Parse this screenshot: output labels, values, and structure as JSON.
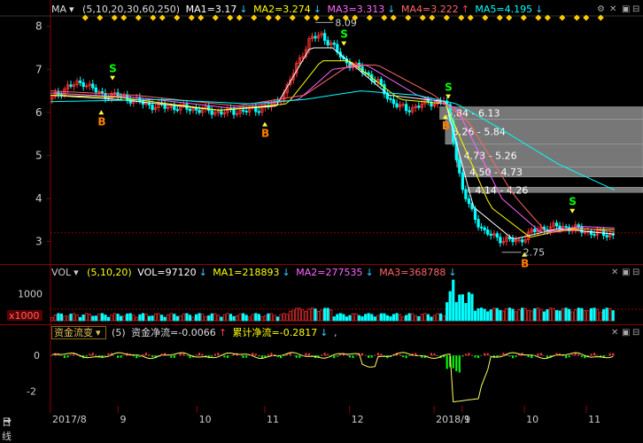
{
  "main_header": {
    "label": "MA",
    "params": "(5,10,20,30,60,250)",
    "ma1": "MA1=3.17",
    "ma2": "MA2=3.274",
    "ma3": "MA3=3.313",
    "ma4": "MA4=3.222",
    "ma5": "MA5=4.195",
    "ma1_arrow": "↓",
    "ma2_arrow": "↓",
    "ma3_arrow": "↓",
    "ma4_arrow": "↑",
    "ma5_arrow": "↓"
  },
  "vol_header": {
    "label": "VOL",
    "params": "(5,10,20)",
    "vol": "VOL=97120",
    "ma1": "MA1=218893",
    "ma2": "MA2=277535",
    "ma3": "MA3=368788",
    "vol_arrow": "↓",
    "ma1_arrow": "↓",
    "ma2_arrow": "↓",
    "ma3_arrow": "↓"
  },
  "flow_header": {
    "selector": "资金流变",
    "params": "(5)",
    "net": "资金净流=-0.0066",
    "cum": "累计净流=-0.2817",
    "net_arrow": "↑",
    "cum_arrow": "↓",
    "tail": ","
  },
  "bottom_bar": {
    "period": "日线",
    "period_arrow": "➜",
    "ticks": [
      "2017/8",
      "9",
      "10",
      "11",
      "12",
      "2018/1",
      "9",
      "10",
      "11"
    ]
  },
  "colors": {
    "up": "#ff3333",
    "down": "#00ffff",
    "ma1": "#ffffff",
    "ma2": "#ffff00",
    "ma3": "#ff66ff",
    "ma4": "#ff6666",
    "ma5": "#00ffff",
    "signal_b": "#ff7f00",
    "signal_s": "#00ff00",
    "grid_red": "#8b0000",
    "flow_line": "#ffff66"
  },
  "chart_data": [
    {
      "type": "candlestick",
      "y_ticks": [
        "8",
        "7",
        "6",
        "5",
        "4",
        "3"
      ],
      "ylim": [
        2.6,
        8.2
      ],
      "annotations": {
        "high": "8.09",
        "low": "2.75"
      },
      "signals": [
        {
          "label": "B",
          "t": 0.09
        },
        {
          "label": "S",
          "t": 0.11
        },
        {
          "label": "B",
          "t": 0.38
        },
        {
          "label": "S",
          "t": 0.52
        },
        {
          "label": "S",
          "t": 0.705
        },
        {
          "label": "B",
          "t": 0.7
        },
        {
          "label": "B",
          "t": 0.84
        },
        {
          "label": "S",
          "t": 0.925
        }
      ],
      "price_profile": [
        {
          "t": 0.0,
          "p": 6.3
        },
        {
          "t": 0.03,
          "p": 6.6
        },
        {
          "t": 0.06,
          "p": 6.7
        },
        {
          "t": 0.09,
          "p": 6.4
        },
        {
          "t": 0.12,
          "p": 6.4
        },
        {
          "t": 0.18,
          "p": 6.15
        },
        {
          "t": 0.24,
          "p": 6.1
        },
        {
          "t": 0.3,
          "p": 6.0
        },
        {
          "t": 0.36,
          "p": 6.05
        },
        {
          "t": 0.4,
          "p": 6.2
        },
        {
          "t": 0.42,
          "p": 6.6
        },
        {
          "t": 0.44,
          "p": 7.2
        },
        {
          "t": 0.46,
          "p": 7.7
        },
        {
          "t": 0.48,
          "p": 7.8
        },
        {
          "t": 0.5,
          "p": 7.55
        },
        {
          "t": 0.52,
          "p": 7.2
        },
        {
          "t": 0.55,
          "p": 7.0
        },
        {
          "t": 0.58,
          "p": 6.7
        },
        {
          "t": 0.6,
          "p": 6.3
        },
        {
          "t": 0.63,
          "p": 6.05
        },
        {
          "t": 0.66,
          "p": 6.2
        },
        {
          "t": 0.69,
          "p": 6.25
        },
        {
          "t": 0.7,
          "p": 6.3
        },
        {
          "t": 0.715,
          "p": 5.3
        },
        {
          "t": 0.73,
          "p": 4.2
        },
        {
          "t": 0.75,
          "p": 3.6
        },
        {
          "t": 0.77,
          "p": 3.2
        },
        {
          "t": 0.8,
          "p": 3.05
        },
        {
          "t": 0.83,
          "p": 3.0
        },
        {
          "t": 0.85,
          "p": 3.2
        },
        {
          "t": 0.87,
          "p": 3.3
        },
        {
          "t": 0.9,
          "p": 3.35
        },
        {
          "t": 0.93,
          "p": 3.3
        },
        {
          "t": 0.96,
          "p": 3.2
        },
        {
          "t": 1.0,
          "p": 3.15
        }
      ],
      "ma_profiles": {
        "ma1": [
          {
            "t": 0.0,
            "p": 6.4
          },
          {
            "t": 0.12,
            "p": 6.3
          },
          {
            "t": 0.3,
            "p": 6.05
          },
          {
            "t": 0.4,
            "p": 6.15
          },
          {
            "t": 0.46,
            "p": 7.5
          },
          {
            "t": 0.5,
            "p": 7.5
          },
          {
            "t": 0.6,
            "p": 6.4
          },
          {
            "t": 0.7,
            "p": 6.25
          },
          {
            "t": 0.75,
            "p": 3.8
          },
          {
            "t": 0.82,
            "p": 3.05
          },
          {
            "t": 0.9,
            "p": 3.3
          },
          {
            "t": 1.0,
            "p": 3.17
          }
        ],
        "ma2": [
          {
            "t": 0.0,
            "p": 6.4
          },
          {
            "t": 0.12,
            "p": 6.35
          },
          {
            "t": 0.3,
            "p": 6.05
          },
          {
            "t": 0.42,
            "p": 6.2
          },
          {
            "t": 0.48,
            "p": 7.2
          },
          {
            "t": 0.53,
            "p": 7.2
          },
          {
            "t": 0.62,
            "p": 6.3
          },
          {
            "t": 0.7,
            "p": 6.2
          },
          {
            "t": 0.78,
            "p": 3.8
          },
          {
            "t": 0.85,
            "p": 3.1
          },
          {
            "t": 0.92,
            "p": 3.3
          },
          {
            "t": 1.0,
            "p": 3.274
          }
        ],
        "ma3": [
          {
            "t": 0.0,
            "p": 6.45
          },
          {
            "t": 0.15,
            "p": 6.35
          },
          {
            "t": 0.32,
            "p": 6.1
          },
          {
            "t": 0.44,
            "p": 6.3
          },
          {
            "t": 0.5,
            "p": 7.0
          },
          {
            "t": 0.56,
            "p": 7.1
          },
          {
            "t": 0.65,
            "p": 6.4
          },
          {
            "t": 0.72,
            "p": 6.1
          },
          {
            "t": 0.8,
            "p": 4.0
          },
          {
            "t": 0.87,
            "p": 3.2
          },
          {
            "t": 0.94,
            "p": 3.35
          },
          {
            "t": 1.0,
            "p": 3.313
          }
        ],
        "ma4": [
          {
            "t": 0.0,
            "p": 6.5
          },
          {
            "t": 0.15,
            "p": 6.4
          },
          {
            "t": 0.33,
            "p": 6.15
          },
          {
            "t": 0.45,
            "p": 6.4
          },
          {
            "t": 0.53,
            "p": 7.1
          },
          {
            "t": 0.58,
            "p": 7.1
          },
          {
            "t": 0.68,
            "p": 6.4
          },
          {
            "t": 0.74,
            "p": 5.8
          },
          {
            "t": 0.82,
            "p": 4.1
          },
          {
            "t": 0.88,
            "p": 3.2
          },
          {
            "t": 0.95,
            "p": 3.3
          },
          {
            "t": 1.0,
            "p": 3.222
          }
        ],
        "ma5": [
          {
            "t": 0.0,
            "p": 6.25
          },
          {
            "t": 0.2,
            "p": 6.3
          },
          {
            "t": 0.35,
            "p": 6.2
          },
          {
            "t": 0.45,
            "p": 6.3
          },
          {
            "t": 0.55,
            "p": 6.5
          },
          {
            "t": 0.65,
            "p": 6.4
          },
          {
            "t": 0.72,
            "p": 6.2
          },
          {
            "t": 0.8,
            "p": 5.6
          },
          {
            "t": 0.9,
            "p": 4.8
          },
          {
            "t": 1.0,
            "p": 4.195
          }
        ]
      },
      "volume_profile": [
        {
          "label": "5.84 - 6.13"
        },
        {
          "label": "5.26 - 5.84"
        },
        {
          "label": "4.73 - 5.26"
        },
        {
          "label": "4.50 - 4.73"
        },
        {
          "label": "4.14 - 4.26"
        }
      ]
    },
    {
      "type": "bar",
      "y_ticks": [
        "1000"
      ],
      "unit_label": "x1000",
      "ylim": [
        0,
        1500
      ]
    },
    {
      "type": "line",
      "y_ticks": [
        "0",
        "-2"
      ],
      "ylim": [
        -3.0,
        0.8
      ]
    }
  ]
}
